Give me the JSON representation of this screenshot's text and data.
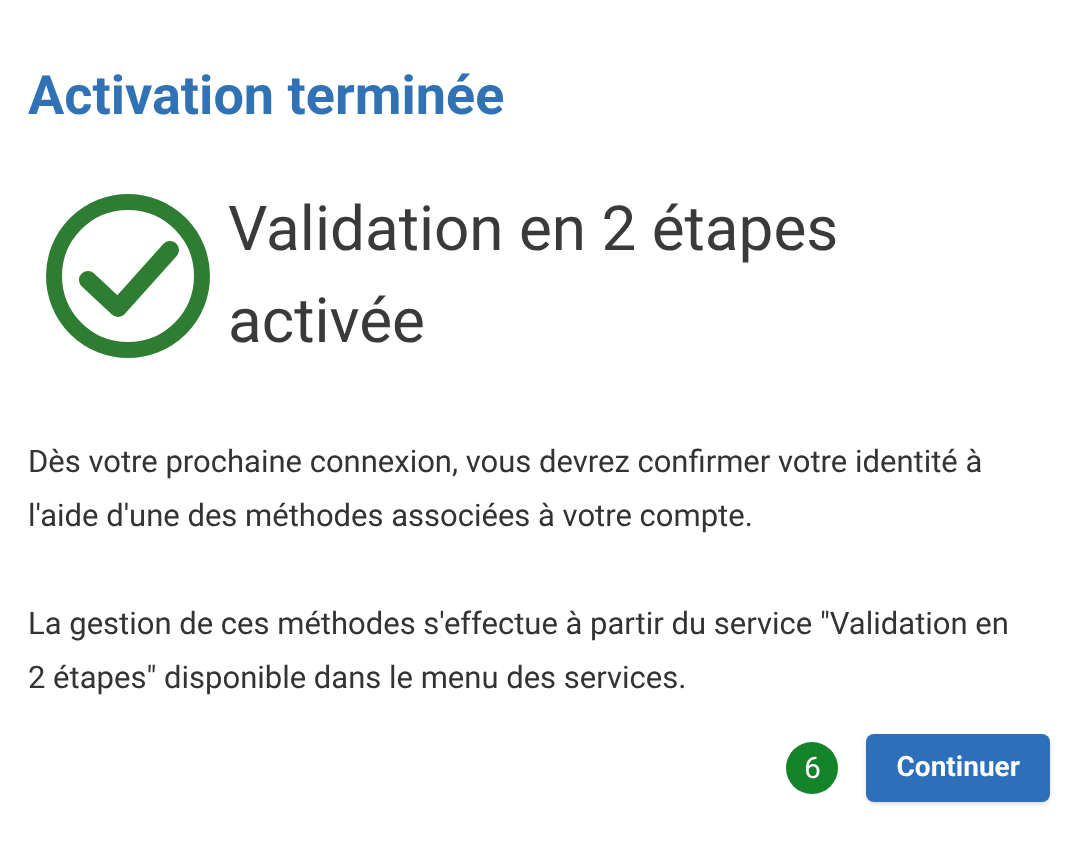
{
  "title": "Activation terminée",
  "status": {
    "heading": "Validation en 2 étapes activée"
  },
  "paragraphs": [
    "Dès votre prochaine connexion, vous devrez confirmer votre identité à l'aide d'une des méthodes associées à votre compte.",
    "La gestion de ces méthodes s'effectue à partir du service \"Validation en 2 étapes\" disponible dans le menu des services."
  ],
  "step_badge": "6",
  "button": "Continuer"
}
